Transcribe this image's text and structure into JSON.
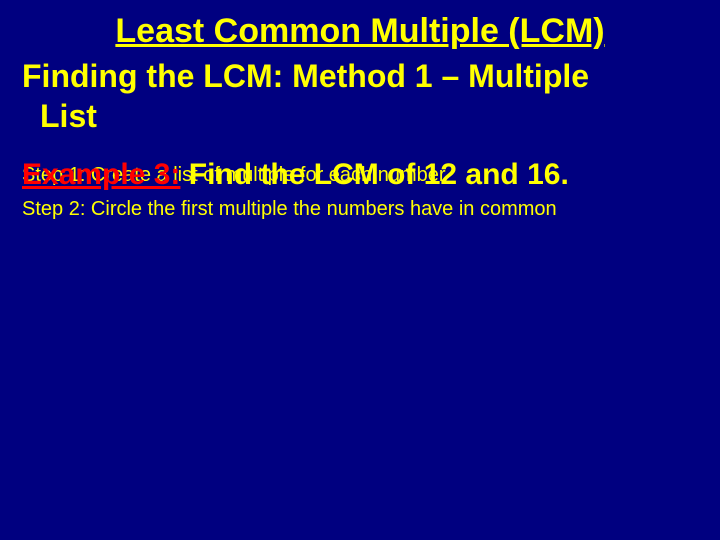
{
  "title": "Least Common Multiple (LCM)",
  "subtitle_line1": "Finding the LCM: Method 1 – Multiple",
  "subtitle_line2": "List",
  "step1": "Step 1: Create a list of multiple for each number",
  "example_label": "Example 3:",
  "example_rest": " Find the LCM of 12 and 16.",
  "step2": "Step 2: Circle the first multiple the numbers have in common"
}
